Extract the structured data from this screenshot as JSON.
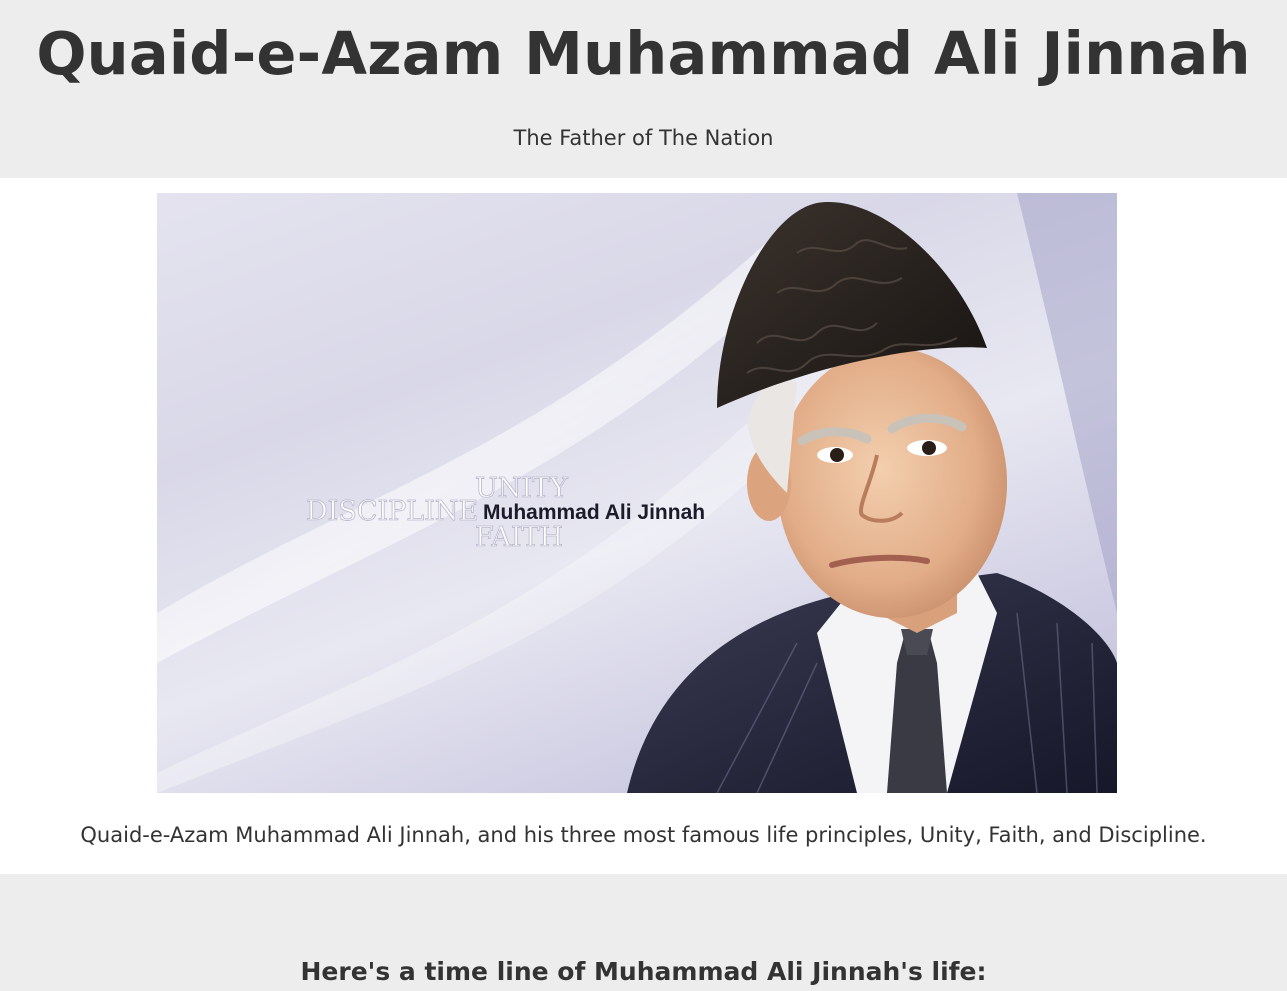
{
  "header": {
    "title": "Quaid-e-Azam Muhammad Ali Jinnah",
    "subtitle": "The Father of The Nation"
  },
  "image": {
    "words": {
      "unity": "UNITY",
      "discipline": "DISCIPLINE",
      "faith": "FAITH",
      "name": "Muhammad Ali Jinnah"
    },
    "colors": {
      "background": "#dedded",
      "cap": "#2a2421",
      "suit": "#2b2b3d",
      "skin": "#e7b894",
      "shirt": "#f4f4f6"
    }
  },
  "caption": "Quaid-e-Azam Muhammad Ali Jinnah, and his three most famous life principles, Unity, Faith, and Discipline.",
  "timeline": {
    "heading": "Here's a time line of Muhammad Ali Jinnah's life:"
  },
  "colors": {
    "section_bg": "#ededed",
    "text": "#333333"
  }
}
